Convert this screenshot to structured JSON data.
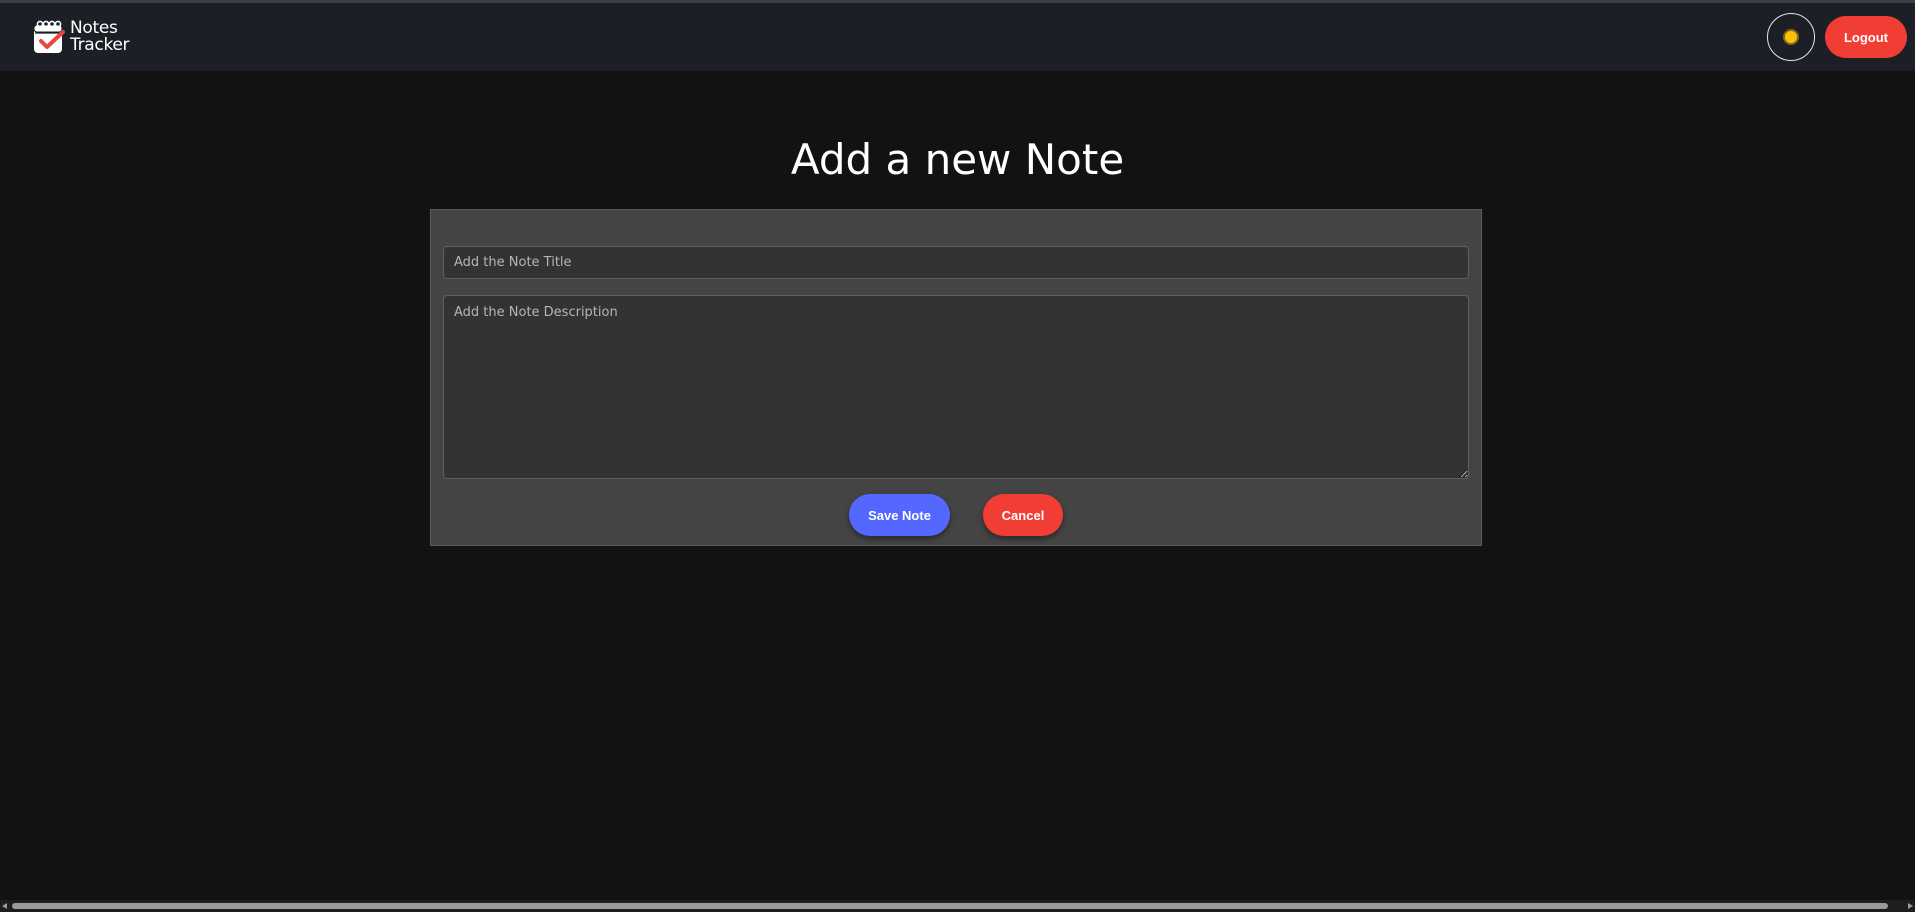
{
  "app": {
    "brand_line1": "Notes",
    "brand_line2": "Tracker",
    "logo_icon": "calendar-check-icon",
    "logout_label": "Logout",
    "theme_icon": "sun-icon"
  },
  "page": {
    "title": "Add a new Note"
  },
  "form": {
    "title_placeholder": "Add the Note Title",
    "title_value": "",
    "description_placeholder": "Add the Note Description",
    "description_value": "",
    "save_label": "Save Note",
    "cancel_label": "Cancel"
  },
  "colors": {
    "background": "#121212",
    "navbar": "#1c1f26",
    "card": "#444444",
    "input": "#333333",
    "primary": "#5468ff",
    "danger": "#f23d35",
    "sun": "#ffc107"
  }
}
